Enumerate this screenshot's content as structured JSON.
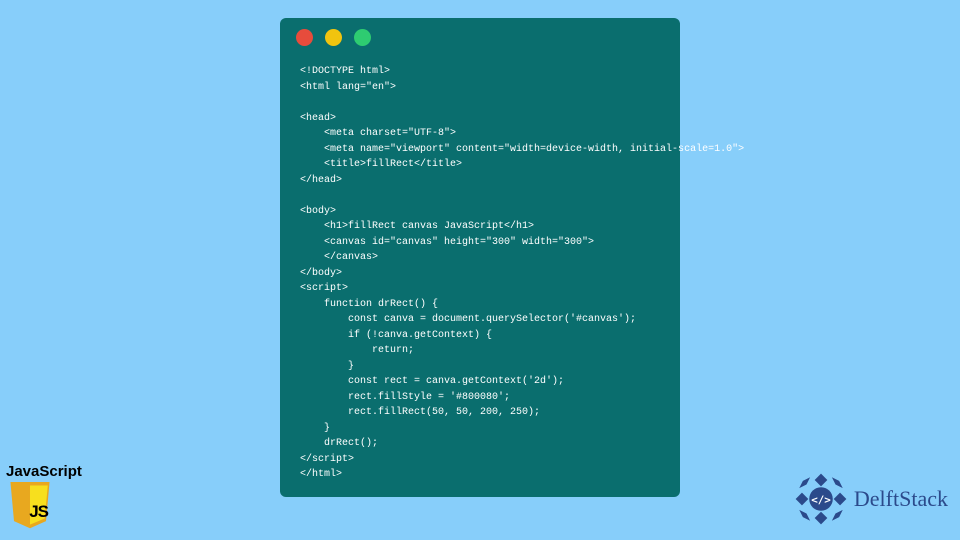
{
  "code": "<!DOCTYPE html>\n<html lang=\"en\">\n\n<head>\n    <meta charset=\"UTF-8\">\n    <meta name=\"viewport\" content=\"width=device-width, initial-scale=1.0\">\n    <title>fillRect</title>\n</head>\n\n<body>\n    <h1>fillRect canvas JavaScript</h1>\n    <canvas id=\"canvas\" height=\"300\" width=\"300\">\n    </canvas>\n</body>\n<script>\n    function drRect() {\n        const canva = document.querySelector('#canvas');\n        if (!canva.getContext) {\n            return;\n        }\n        const rect = canva.getContext('2d');\n        rect.fillStyle = '#800080';\n        rect.fillRect(50, 50, 200, 250);\n    }\n    drRect();\n</script>\n</html>",
  "window": {
    "dots": [
      "red",
      "yellow",
      "green"
    ]
  },
  "js_badge": {
    "label": "JavaScript",
    "logo_text": "JS"
  },
  "brand": {
    "name": "DelftStack"
  },
  "colors": {
    "page_bg": "#87cefa",
    "window_bg": "#0a6e6e",
    "code_fg": "#ffffff",
    "js_shield": "#f7df1e",
    "brand_blue": "#2b4a8b"
  }
}
